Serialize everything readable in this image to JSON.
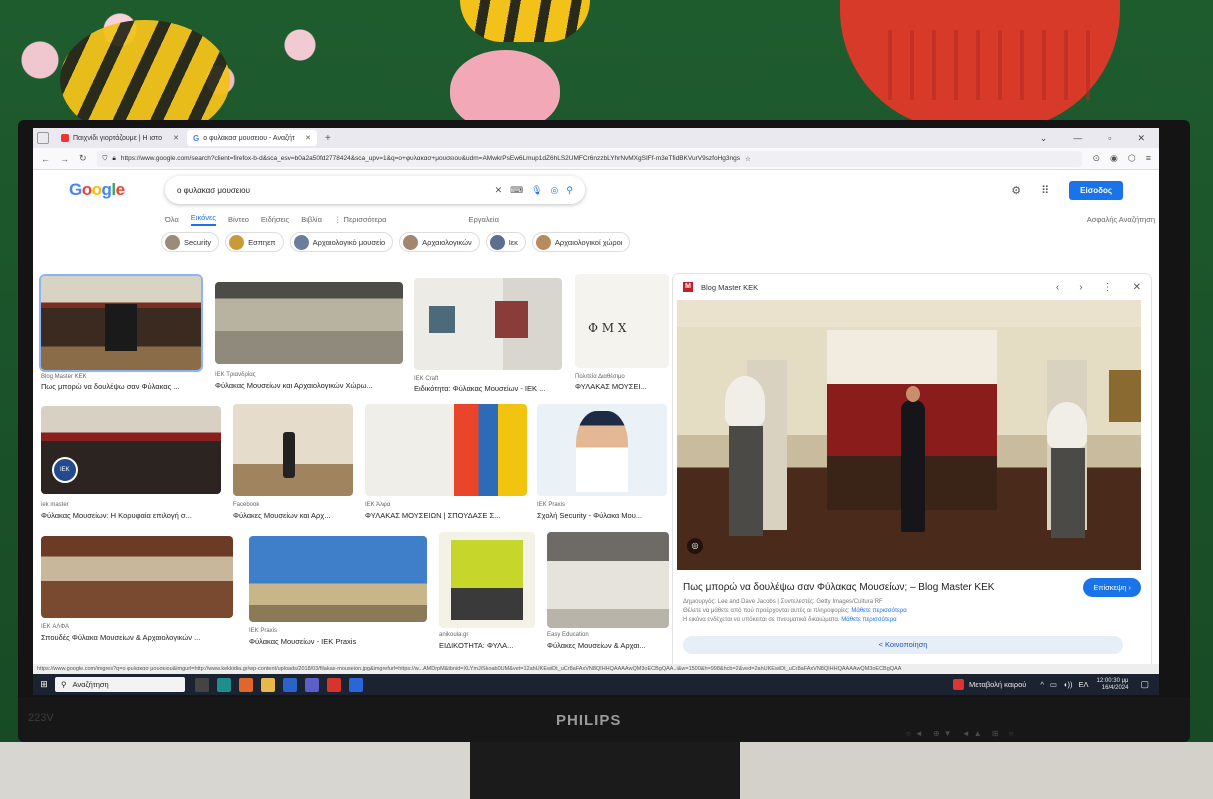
{
  "scene": {
    "monitor_brand": "PHILIPS",
    "monitor_model": "223V"
  },
  "browser": {
    "tabs": [
      {
        "label": "Παιχνίδι γιορτάζουμε | Η ιστο",
        "active": false
      },
      {
        "label": "ο φυλακασ μουσειου - Αναζήτ",
        "active": true
      }
    ],
    "url": "https://www.google.com/search?client=firefox-b-d&sca_esv=b0a2a50fd2778424&sca_upv=1&q=ο+φυλακασ+μουσειου&udm=AMwkrPsEw6Lmup1dZ6hLS2UMFCr6nzzbLYhrNvMXgSIFf-m3eTfidBKVurV9szfoHg3ngs"
  },
  "google": {
    "logo": "Google",
    "query": "ο φυλακασ μουσειου",
    "signin": "Είσοδος",
    "tabs": [
      "Όλα",
      "Εικόνες",
      "Βίντεο",
      "Ειδήσεις",
      "Βιβλία",
      "⋮ Περισσότερα"
    ],
    "tools": "Εργαλεία",
    "safe_search": "Ασφαλής Αναζήτηση",
    "chips": [
      "Security",
      "Εσπηεπ",
      "Αρχαιολογικό μουσείο",
      "Αρχαιολογικών",
      "Ιεκ",
      "Αρχαιολογικοί χώροι"
    ]
  },
  "results": [
    {
      "source": "Blog Master KEK",
      "title": "Πως μπορώ να δουλέψω σαν Φύλακας ..."
    },
    {
      "source": "ΙΕΚ Τριανδρίας",
      "title": "Φύλακας Μουσείων και Αρχαιολογικών Χώρω..."
    },
    {
      "source": "IEK Craft",
      "title": "Ειδικότητα: Φύλακας Μουσείων - ΙΕΚ ..."
    },
    {
      "source": "Πολιτεία Διαθέσιμο",
      "title": "ΦΥΛΑΚΑΣ ΜΟΥΣΕΙ..."
    },
    {
      "source": "iek master",
      "title": "Φύλακας Μουσείων: Η Κορυφαία επιλογή σ..."
    },
    {
      "source": "Facebook",
      "title": "Φύλακες Μουσείων και Αρχ..."
    },
    {
      "source": "ΙΕΚ Άλφα",
      "title": "ΦΥΛΑΚΑΣ ΜΟΥΣΕΙΩΝ | ΣΠΟΥΔΑΣΕ Σ..."
    },
    {
      "source": "IEK Praxis",
      "title": "Σχολή Security - Φύλακα Μου..."
    },
    {
      "source": "IEK ΑΛΦΑ",
      "title": "Σπουδές Φύλακα Μουσείων & Αρχαιολογικών ..."
    },
    {
      "source": "IEK Praxis",
      "title": "Φύλακας Μουσείων - IEK Praxis"
    },
    {
      "source": "anikoula.gr",
      "title": "ΕΙΔΙΚΟΤΗΤΑ: ΦΥΛΑ..."
    },
    {
      "source": "Easy Education",
      "title": "Φύλακες Μουσείων & Αρχαι..."
    }
  ],
  "preview": {
    "source": "Blog Master KEK",
    "title": "Πως μπορώ να δουλέψω σαν Φύλακας Μουσείων; – Blog Master KEK",
    "visit": "Επίσκεψη ›",
    "credit": "Δημιουργός: Lee and Dave Jacobs | Συντελεστές: Getty Images/Cultura RF",
    "line2": "Θέλετε να μάθετε από πού προέρχονται αυτές οι πληροφορίες;",
    "line3": "Η εικόνα ενδέχεται να υπόκειται σε πνευματικά δικαιώματα.",
    "more": "Μάθετε περισσότερα",
    "share": "Κοινοποίηση"
  },
  "status_url": "https://www.google.com/imgres?q=ο φυλακασ μουσειου&imgurl=http://www.kekkidia.gr/wp-content/uploads/2018/03/filakas-mouseion.jpg&imgrefurl=https://w...AMDrpM&tbnid=XLYmJiSkoab0UM&vet=12ahUKEwiDt_uCr8aFAxVN8QIHHQAAAAwQM3oECBgQAA..i&w=1500&h=998&hcb=2&ved=2ahUKEwiDt_uCr8aFAxVN8QIHHQAAAAwQM3oECBgQAA",
  "taskbar": {
    "search_placeholder": "Αναζήτηση",
    "weather": "Μεταβολή καιρού",
    "lang": "ΕΛ",
    "time": "12:00:30 μμ",
    "date": "16/4/2024"
  }
}
